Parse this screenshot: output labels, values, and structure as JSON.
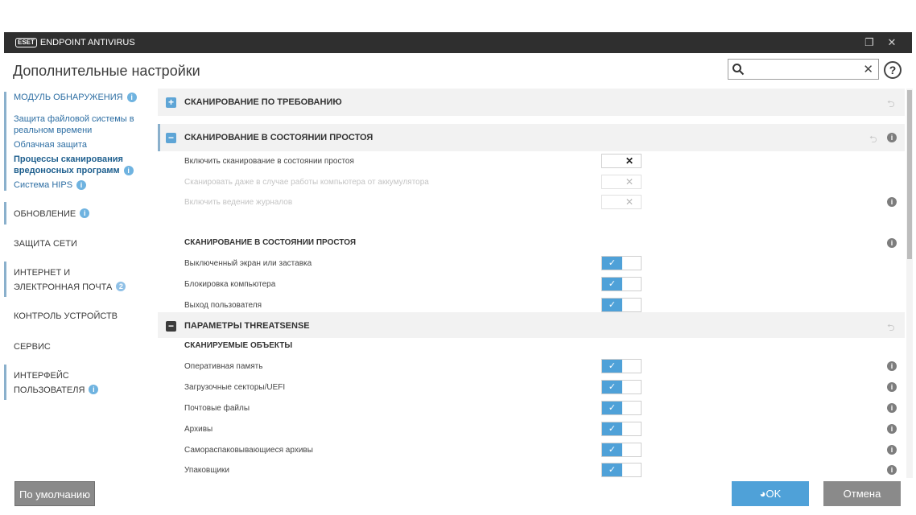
{
  "window": {
    "brand": "ESET",
    "product": "ENDPOINT ANTIVIRUS",
    "restore_icon": "restore-icon",
    "close_icon": "close-icon"
  },
  "header": {
    "title": "Дополнительные настройки",
    "search_placeholder": "",
    "help": "?"
  },
  "sidebar": {
    "detection": {
      "label": "МОДУЛЬ ОБНАРУЖЕНИЯ",
      "badge": "i"
    },
    "detection_sub": [
      {
        "label": "Защита файловой системы в реальном времени"
      },
      {
        "label": "Облачная защита"
      },
      {
        "label": "Процессы сканирования вредоносных программ",
        "badge": "i"
      },
      {
        "label": "Система HIPS",
        "badge": "i"
      }
    ],
    "update": {
      "label": "ОБНОВЛЕНИЕ",
      "badge": "i"
    },
    "network": {
      "label": "ЗАЩИТА СЕТИ"
    },
    "web": {
      "label": "ИНТЕРНЕТ И ЭЛЕКТРОННАЯ ПОЧТА",
      "badge": "2"
    },
    "device": {
      "label": "КОНТРОЛЬ УСТРОЙСТВ"
    },
    "service": {
      "label": "СЕРВИС"
    },
    "ui": {
      "label": "ИНТЕРФЕЙС ПОЛЬЗОВАТЕЛЯ",
      "badge": "i"
    }
  },
  "content": {
    "section1": {
      "title": "СКАНИРОВАНИЕ ПО ТРЕБОВАНИЮ",
      "icon": "+"
    },
    "section2": {
      "title": "СКАНИРОВАНИЕ В СОСТОЯНИИ ПРОСТОЯ",
      "icon": "−"
    },
    "idle_settings": [
      {
        "label": "Включить сканирование в состоянии простоя",
        "value": "✕",
        "disabled": false
      },
      {
        "label": "Сканировать даже в случае работы компьютера от аккумулятора",
        "value": "✕",
        "disabled": true
      },
      {
        "label": "Включить ведение журналов",
        "value": "✕",
        "disabled": true
      }
    ],
    "idle_triggers_heading": "СКАНИРОВАНИЕ В СОСТОЯНИИ ПРОСТОЯ",
    "idle_triggers": [
      {
        "label": "Выключенный экран или заставка",
        "checked": "✓"
      },
      {
        "label": "Блокировка компьютера",
        "checked": "✓"
      },
      {
        "label": "Выход пользователя",
        "checked": "✓"
      }
    ],
    "section3": {
      "title": "ПАРАМЕТРЫ THREATSENSE",
      "icon": "−"
    },
    "objects_heading": "СКАНИРУЕМЫЕ ОБЪЕКТЫ",
    "objects": [
      {
        "label": "Оперативная память",
        "checked": "✓"
      },
      {
        "label": "Загрузочные секторы/UEFI",
        "checked": "✓"
      },
      {
        "label": "Почтовые файлы",
        "checked": "✓"
      },
      {
        "label": "Архивы",
        "checked": "✓"
      },
      {
        "label": "Самораспаковывающиеся архивы",
        "checked": "✓"
      },
      {
        "label": "Упаковщики",
        "checked": "✓"
      }
    ]
  },
  "footer": {
    "default_label": "По умолчанию",
    "ok_label": "OK",
    "cancel_label": "Отмена"
  },
  "colors": {
    "accent": "#4fa1d8",
    "titlebar": "#2f2f2f",
    "button_gray": "#8a8a8a"
  }
}
